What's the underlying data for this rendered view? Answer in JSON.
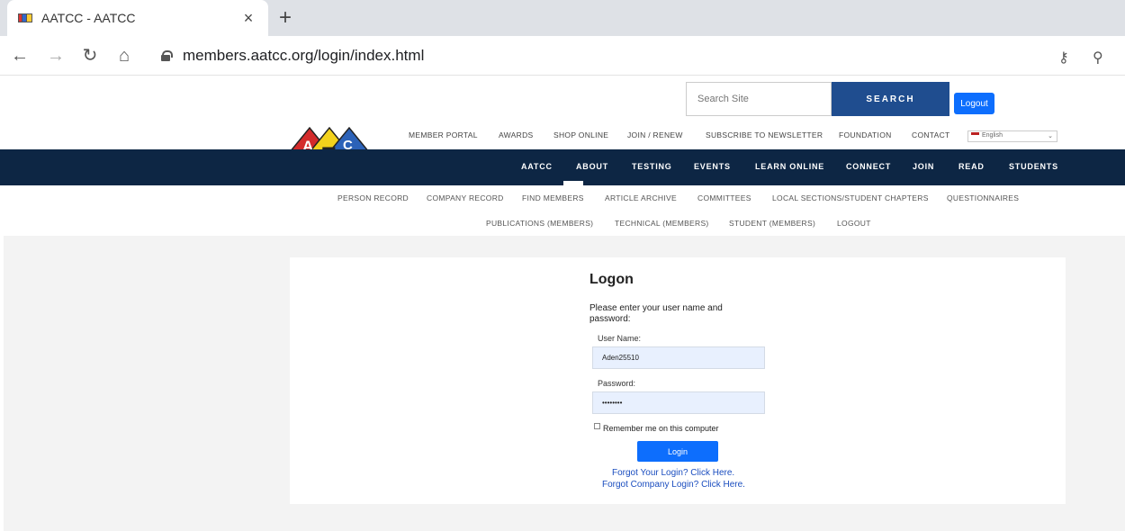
{
  "browser": {
    "tab_title": "AATCC - AATCC",
    "tab_close": "×",
    "new_tab": "+",
    "url": "members.aatcc.org/login/index.html"
  },
  "header": {
    "search_placeholder": "Search Site",
    "search_button": "SEARCH",
    "logout_button": "Logout",
    "logo_letters": [
      "A",
      "T",
      "C",
      "A",
      "C"
    ],
    "top_nav": [
      "MEMBER PORTAL",
      "AWARDS",
      "SHOP ONLINE",
      "JOIN / RENEW",
      "SUBSCRIBE TO NEWSLETTER",
      "FOUNDATION",
      "CONTACT"
    ],
    "language": "English"
  },
  "main_nav": {
    "items": [
      "AATCC",
      "ABOUT",
      "TESTING",
      "EVENTS",
      "LEARN ONLINE",
      "CONNECT",
      "JOIN",
      "READ",
      "STUDENTS"
    ],
    "active": "ABOUT"
  },
  "sub_nav": {
    "row1": [
      "PERSON RECORD",
      "COMPANY RECORD",
      "FIND MEMBERS",
      "ARTICLE ARCHIVE",
      "COMMITTEES",
      "LOCAL SECTIONS/STUDENT CHAPTERS",
      "QUESTIONNAIRES"
    ],
    "row2": [
      "PUBLICATIONS (MEMBERS)",
      "TECHNICAL (MEMBERS)",
      "STUDENT (MEMBERS)",
      "LOGOUT"
    ]
  },
  "logon": {
    "title": "Logon",
    "description": "Please enter your user name and password:",
    "username_label": "User Name:",
    "username_value": "Aden25510",
    "password_label": "Password:",
    "password_value": "••••••••",
    "remember_label": "Remember me on this computer",
    "login_button": "Login",
    "forgot_login": "Forgot Your Login? Click Here.",
    "forgot_company": "Forgot Company Login? Click Here."
  },
  "colors": {
    "nav_bg": "#0d2644",
    "search_btn": "#1f4d8f",
    "primary_btn": "#0d6efd",
    "link": "#1a4dbf"
  }
}
